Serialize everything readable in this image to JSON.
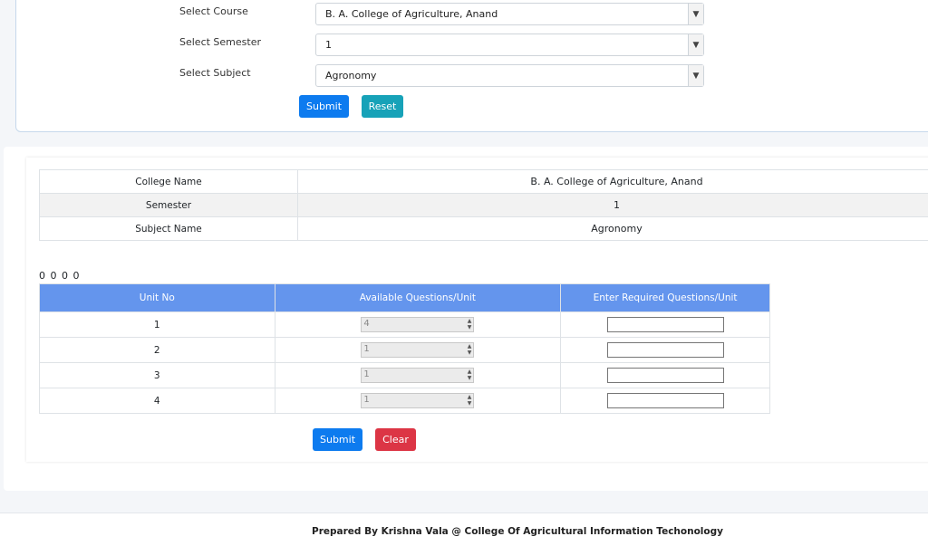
{
  "filter_form": {
    "course_label": "Select Course",
    "course_value": "B. A. College of Agriculture, Anand",
    "semester_label": "Select Semester",
    "semester_value": "1",
    "subject_label": "Select Subject",
    "subject_value": "Agronomy",
    "submit_label": "Submit",
    "reset_label": "Reset"
  },
  "info_table": {
    "college_label": "College Name",
    "college_value": "B. A. College of Agriculture, Anand",
    "semester_label": "Semester",
    "semester_value": "1",
    "subject_label": "Subject Name",
    "subject_value": "Agronomy"
  },
  "zeros_text": "0 0 0 0",
  "unit_table": {
    "headers": [
      "Unit No",
      "Available Questions/Unit",
      "Enter Required Questions/Unit"
    ],
    "rows": [
      {
        "unit": "1",
        "available": "4"
      },
      {
        "unit": "2",
        "available": "1"
      },
      {
        "unit": "3",
        "available": "1"
      },
      {
        "unit": "4",
        "available": "1"
      }
    ]
  },
  "actions": {
    "submit_label": "Submit",
    "clear_label": "Clear"
  },
  "footer": {
    "text": "Prepared By Krishna Vala @ College Of Agricultural Information Techonology"
  },
  "colors": {
    "primary": "#0d7bef",
    "info": "#17a2b8",
    "danger": "#dc3545",
    "table_header": "#6495ed"
  }
}
